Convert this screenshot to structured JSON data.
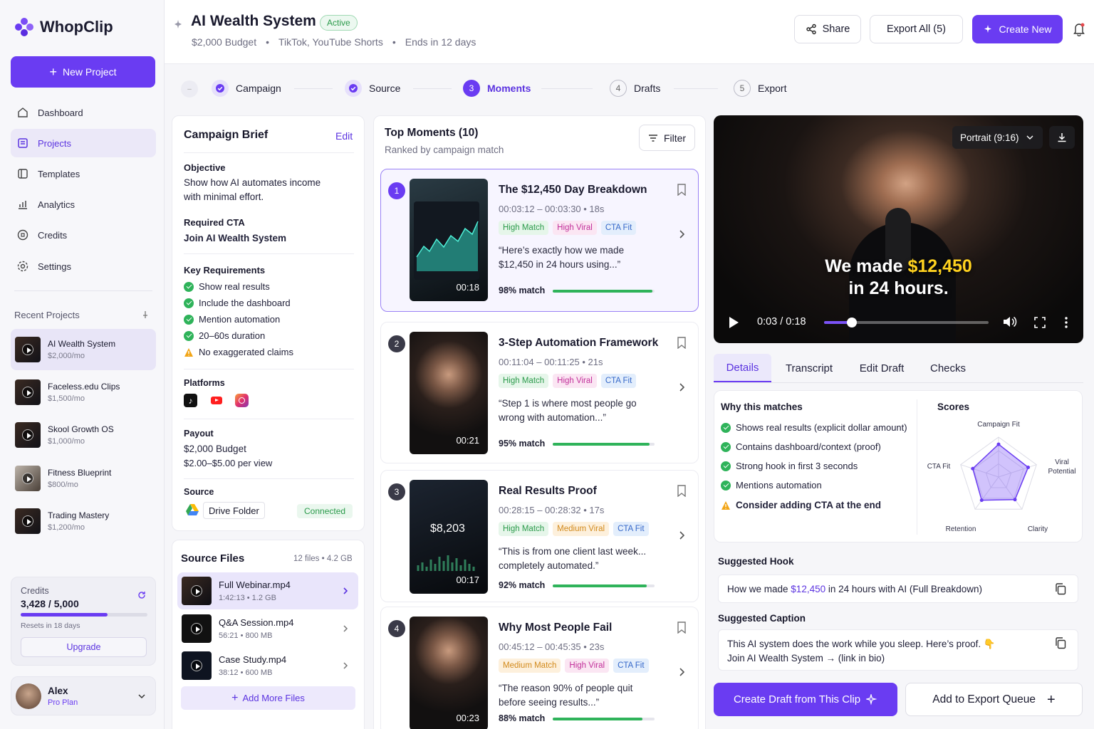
{
  "app": {
    "name": "WhopClip"
  },
  "sidebar": {
    "new_project": "New Project",
    "nav": [
      {
        "label": "Dashboard",
        "icon": "home-icon"
      },
      {
        "label": "Projects",
        "icon": "projects-icon"
      },
      {
        "label": "Templates",
        "icon": "templates-icon"
      },
      {
        "label": "Analytics",
        "icon": "analytics-icon"
      },
      {
        "label": "Credits",
        "icon": "credits-icon"
      },
      {
        "label": "Settings",
        "icon": "settings-icon"
      }
    ],
    "recent_title": "Recent Projects",
    "recent": [
      {
        "name": "AI Wealth System",
        "price": "$2,000/mo"
      },
      {
        "name": "Faceless.edu Clips",
        "price": "$1,500/mo"
      },
      {
        "name": "Skool Growth OS",
        "price": "$1,000/mo"
      },
      {
        "name": "Fitness Blueprint",
        "price": "$800/mo"
      },
      {
        "name": "Trading Mastery",
        "price": "$1,200/mo"
      }
    ],
    "credits": {
      "label": "Credits",
      "value": "3,428 / 5,000",
      "progress": 0.686,
      "resets": "Resets in 18 days",
      "upgrade": "Upgrade"
    },
    "user": {
      "name": "Alex",
      "plan": "Pro Plan"
    }
  },
  "header": {
    "title": "AI Wealth System",
    "status": "Active",
    "budget": "$2,000 Budget",
    "platforms": "TikTok, YouTube Shorts",
    "ends": "Ends in 12 days",
    "share": "Share",
    "export_all": "Export All (5)",
    "create_new": "Create New"
  },
  "steps": [
    {
      "label": "Campaign",
      "state": "done"
    },
    {
      "label": "Source",
      "state": "done"
    },
    {
      "label": "Moments",
      "state": "active",
      "num": "3"
    },
    {
      "label": "Drafts",
      "state": "todo",
      "num": "4"
    },
    {
      "label": "Export",
      "state": "todo",
      "num": "5"
    }
  ],
  "brief": {
    "title": "Campaign Brief",
    "edit": "Edit",
    "objective_label": "Objective",
    "objective_line1": "Show how AI automates income",
    "objective_line2": "with minimal effort.",
    "cta_label": "Required CTA",
    "cta": "Join AI Wealth System",
    "req_label": "Key Requirements",
    "requirements": [
      {
        "text": "Show real results",
        "ok": true
      },
      {
        "text": "Include the dashboard",
        "ok": true
      },
      {
        "text": "Mention automation",
        "ok": true
      },
      {
        "text": "20–60s duration",
        "ok": true
      },
      {
        "text": "No exaggerated claims",
        "ok": false
      }
    ],
    "platforms_label": "Platforms",
    "payout_label": "Payout",
    "payout_budget": "$2,000 Budget",
    "payout_rate": "$2.00–$5.00 per view",
    "source_label": "Source",
    "source": "Drive Folder",
    "source_status": "Connected"
  },
  "files": {
    "title": "Source Files",
    "meta": "12 files  •  4.2 GB",
    "items": [
      {
        "name": "Full Webinar.mp4",
        "meta": "1:42:13  •  1.2 GB"
      },
      {
        "name": "Q&A Session.mp4",
        "meta": "56:21  •  800 MB"
      },
      {
        "name": "Case Study.mp4",
        "meta": "38:12  •  600 MB"
      }
    ],
    "add": "Add More Files"
  },
  "moments": {
    "title": "Top Moments (10)",
    "subtitle": "Ranked by campaign match",
    "filter": "Filter",
    "items": [
      {
        "num": "1",
        "title": "The $12,450 Day Breakdown",
        "time": "00:03:12  –  00:03:30   •   18s",
        "tags": [
          "High Match",
          "High Viral",
          "CTA Fit"
        ],
        "quote1": "“Here’s exactly how we made",
        "quote2": "$12,450 in 24 hours using...”",
        "match": "98% match",
        "pct": 0.98,
        "dur": "00:18"
      },
      {
        "num": "2",
        "title": "3-Step Automation Framework",
        "time": "00:11:04  –  00:11:25   •   21s",
        "tags": [
          "High Match",
          "High Viral",
          "CTA Fit"
        ],
        "quote1": "“Step 1 is where most people go",
        "quote2": "wrong with automation...”",
        "match": "95% match",
        "pct": 0.95,
        "dur": "00:21"
      },
      {
        "num": "3",
        "title": "Real Results Proof",
        "time": "00:28:15  –  00:28:32   •   17s",
        "tags": [
          "High Match",
          "Medium Viral",
          "CTA Fit"
        ],
        "quote1": "“This is from one client last week...",
        "quote2": "completely automated.”",
        "match": "92% match",
        "pct": 0.92,
        "dur": "00:17",
        "screen_value": "$8,203"
      },
      {
        "num": "4",
        "title": "Why Most People Fail",
        "time": "00:45:12  –  00:45:35   •   23s",
        "tags": [
          "Medium Match",
          "High Viral",
          "CTA Fit"
        ],
        "quote1": "“The reason 90% of people quit",
        "quote2": "before seeing results...”",
        "match": "88% match",
        "pct": 0.88,
        "dur": "00:23"
      }
    ]
  },
  "player": {
    "format": "Portrait (9:16)",
    "caption_pre": "We made ",
    "caption_amount": "$12,450",
    "caption_line2": "in 24 hours.",
    "time": "0:03 / 0:18",
    "progress": 0.167
  },
  "detail_tabs": [
    "Details",
    "Transcript",
    "Edit Draft",
    "Checks"
  ],
  "details": {
    "why_title": "Why this matches",
    "reasons": [
      {
        "text": "Shows real results (explicit dollar amount)",
        "ok": true
      },
      {
        "text": "Contains dashboard/context (proof)",
        "ok": true
      },
      {
        "text": "Strong hook in first 3 seconds",
        "ok": true
      },
      {
        "text": "Mentions automation",
        "ok": true
      },
      {
        "text": "Consider adding CTA at the end",
        "ok": false
      }
    ],
    "scores_title": "Scores",
    "scores": [
      {
        "label": "Campaign Fit",
        "value": 0.82
      },
      {
        "label": "Viral Potential",
        "value": 0.78
      },
      {
        "label": "Clarity",
        "value": 0.7
      },
      {
        "label": "Retention",
        "value": 0.72
      },
      {
        "label": "CTA Fit",
        "value": 0.68
      }
    ],
    "hook_title": "Suggested Hook",
    "hook_pre": "How we made ",
    "hook_amount": "$12,450",
    "hook_post": " in 24 hours with AI (Full Breakdown)",
    "caption_title": "Suggested Caption",
    "caption_line1": "This AI system does the work while you sleep. Here’s proof. 👇",
    "caption_line2": "Join AI Wealth System → (link in bio)",
    "create_draft": "Create Draft from This Clip",
    "add_export": "Add to Export Queue"
  },
  "colors": {
    "accent": "#6a3cf2",
    "success": "#2fb35a",
    "warning": "#f2a516"
  }
}
